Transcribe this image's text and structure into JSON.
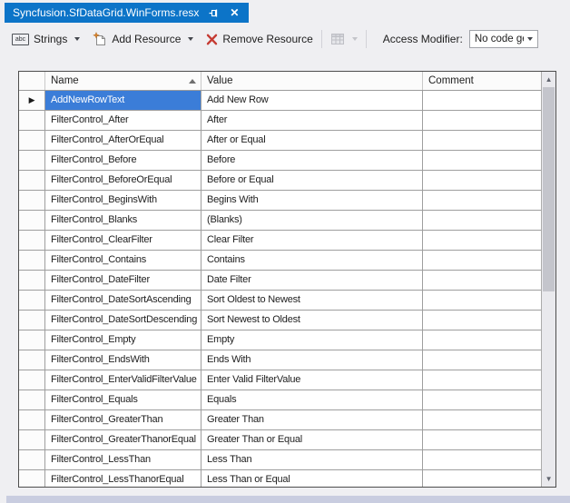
{
  "tab": {
    "title": "Syncfusion.SfDataGrid.WinForms.resx"
  },
  "toolbar": {
    "strings_label": "Strings",
    "add_resource_label": "Add Resource",
    "remove_resource_label": "Remove Resource",
    "access_modifier_label": "Access Modifier:",
    "access_modifier_value": "No code gene",
    "abc_icon_text": "abc"
  },
  "grid": {
    "columns": [
      "Name",
      "Value",
      "Comment"
    ],
    "selected_row": 0,
    "rows": [
      {
        "name": "AddNewRowText",
        "value": "Add New Row",
        "comment": ""
      },
      {
        "name": "FilterControl_After",
        "value": "After",
        "comment": ""
      },
      {
        "name": "FilterControl_AfterOrEqual",
        "value": "After or Equal",
        "comment": ""
      },
      {
        "name": "FilterControl_Before",
        "value": "Before",
        "comment": ""
      },
      {
        "name": "FilterControl_BeforeOrEqual",
        "value": "Before or Equal",
        "comment": ""
      },
      {
        "name": "FilterControl_BeginsWith",
        "value": "Begins With",
        "comment": ""
      },
      {
        "name": "FilterControl_Blanks",
        "value": "(Blanks)",
        "comment": ""
      },
      {
        "name": "FilterControl_ClearFilter",
        "value": "Clear Filter",
        "comment": ""
      },
      {
        "name": "FilterControl_Contains",
        "value": "Contains",
        "comment": ""
      },
      {
        "name": "FilterControl_DateFilter",
        "value": "Date Filter",
        "comment": ""
      },
      {
        "name": "FilterControl_DateSortAscending",
        "value": "Sort Oldest to Newest",
        "comment": ""
      },
      {
        "name": "FilterControl_DateSortDescending",
        "value": "Sort Newest to Oldest",
        "comment": ""
      },
      {
        "name": "FilterControl_Empty",
        "value": "Empty",
        "comment": ""
      },
      {
        "name": "FilterControl_EndsWith",
        "value": "Ends With",
        "comment": ""
      },
      {
        "name": "FilterControl_EnterValidFilterValue",
        "value": "Enter Valid FilterValue",
        "comment": ""
      },
      {
        "name": "FilterControl_Equals",
        "value": "Equals",
        "comment": ""
      },
      {
        "name": "FilterControl_GreaterThan",
        "value": "Greater Than",
        "comment": ""
      },
      {
        "name": "FilterControl_GreaterThanorEqual",
        "value": "Greater Than or Equal",
        "comment": ""
      },
      {
        "name": "FilterControl_LessThan",
        "value": "Less Than",
        "comment": ""
      },
      {
        "name": "FilterControl_LessThanorEqual",
        "value": "Less Than or Equal",
        "comment": ""
      }
    ]
  },
  "colors": {
    "tab_active_bg": "#0C74C8",
    "selection_bg": "#3B7DD8",
    "remove_icon_red": "#C53B33",
    "add_sparkle_orange": "#D9822B",
    "background": "#EFEFF2",
    "bottom_strip": "#C9CDE0"
  }
}
